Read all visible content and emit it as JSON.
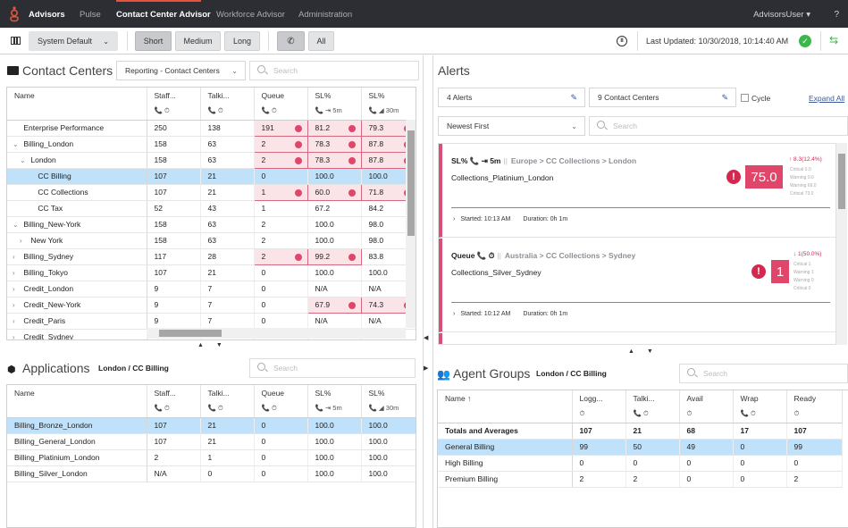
{
  "nav": {
    "brand": "Advisors",
    "items": [
      "Pulse",
      "Contact Center Advisor",
      "Workforce Advisor",
      "Administration"
    ],
    "active": "Contact Center Advisor",
    "user": "AdvisorsUser ▾",
    "help": "?"
  },
  "toolbar": {
    "layout_select": "System Default",
    "time_buttons": [
      "Short",
      "Medium",
      "Long"
    ],
    "media_buttons": [
      "phone",
      "All"
    ],
    "last_updated": "Last Updated: 10/30/2018, 10:14:40 AM",
    "status": "connected"
  },
  "contact_centers": {
    "title": "Contact Centers",
    "grouping": "Reporting - Contact Centers",
    "search_placeholder": "Search",
    "columns": [
      {
        "label": "Name",
        "sub": ""
      },
      {
        "label": "Staff...",
        "sub": "📞 ⏱"
      },
      {
        "label": "Talki...",
        "sub": "📞 ⏱"
      },
      {
        "label": "Queue",
        "sub": "📞 ⏱"
      },
      {
        "label": "SL%",
        "sub": "📞 ⇥ 5m"
      },
      {
        "label": "SL%",
        "sub": "📞 ◢ 30m"
      }
    ],
    "rows": [
      {
        "toggle": "",
        "indent": 1,
        "name": "Enterprise Performance",
        "staff": "250",
        "talking": "138",
        "queue": "191",
        "sl5": "81.2",
        "sl30": "79.3",
        "alerts": [
          "queue",
          "sl5",
          "sl30"
        ]
      },
      {
        "toggle": "⌄",
        "indent": 1,
        "name": "Billing_London",
        "staff": "158",
        "talking": "63",
        "queue": "2",
        "sl5": "78.3",
        "sl30": "87.8",
        "alerts": [
          "queue",
          "sl5",
          "sl30"
        ]
      },
      {
        "toggle": "⌄",
        "indent": 2,
        "name": "London",
        "staff": "158",
        "talking": "63",
        "queue": "2",
        "sl5": "78.3",
        "sl30": "87.8",
        "alerts": [
          "queue",
          "sl5",
          "sl30"
        ]
      },
      {
        "toggle": "",
        "indent": 3,
        "name": "CC Billing",
        "staff": "107",
        "talking": "21",
        "queue": "0",
        "sl5": "100.0",
        "sl30": "100.0",
        "alerts": [],
        "selected": true
      },
      {
        "toggle": "",
        "indent": 3,
        "name": "CC Collections",
        "staff": "107",
        "talking": "21",
        "queue": "1",
        "sl5": "60.0",
        "sl30": "71.8",
        "alerts": [
          "queue",
          "sl5",
          "sl30"
        ]
      },
      {
        "toggle": "",
        "indent": 3,
        "name": "CC Tax",
        "staff": "52",
        "talking": "43",
        "queue": "1",
        "sl5": "67.2",
        "sl30": "84.2",
        "alerts": []
      },
      {
        "toggle": "⌄",
        "indent": 1,
        "name": "Billing_New-York",
        "staff": "158",
        "talking": "63",
        "queue": "2",
        "sl5": "100.0",
        "sl30": "98.0",
        "alerts": []
      },
      {
        "toggle": "›",
        "indent": 2,
        "name": "New York",
        "staff": "158",
        "talking": "63",
        "queue": "2",
        "sl5": "100.0",
        "sl30": "98.0",
        "alerts": []
      },
      {
        "toggle": "›",
        "indent": 1,
        "name": "Billing_Sydney",
        "staff": "117",
        "talking": "28",
        "queue": "2",
        "sl5": "99.2",
        "sl30": "83.8",
        "alerts": [
          "queue",
          "sl5"
        ]
      },
      {
        "toggle": "›",
        "indent": 1,
        "name": "Billing_Tokyo",
        "staff": "107",
        "talking": "21",
        "queue": "0",
        "sl5": "100.0",
        "sl30": "100.0",
        "alerts": []
      },
      {
        "toggle": "›",
        "indent": 1,
        "name": "Credit_London",
        "staff": "9",
        "talking": "7",
        "queue": "0",
        "sl5": "N/A",
        "sl30": "N/A",
        "alerts": []
      },
      {
        "toggle": "›",
        "indent": 1,
        "name": "Credit_New-York",
        "staff": "9",
        "talking": "7",
        "queue": "0",
        "sl5": "67.9",
        "sl30": "74.3",
        "alerts": [
          "sl5",
          "sl30"
        ]
      },
      {
        "toggle": "›",
        "indent": 1,
        "name": "Credit_Paris",
        "staff": "9",
        "talking": "7",
        "queue": "0",
        "sl5": "N/A",
        "sl30": "N/A",
        "alerts": []
      },
      {
        "toggle": "›",
        "indent": 1,
        "name": "Credit_Sydney",
        "staff": "",
        "talking": "",
        "queue": "",
        "sl5": "",
        "sl30": "",
        "alerts": []
      }
    ]
  },
  "applications": {
    "title": "Applications",
    "context": "London / CC Billing",
    "search_placeholder": "Search",
    "columns": [
      {
        "label": "Name",
        "sub": ""
      },
      {
        "label": "Staff...",
        "sub": "📞 ⏱"
      },
      {
        "label": "Talki...",
        "sub": "📞 ⏱"
      },
      {
        "label": "Queue",
        "sub": "📞 ⏱"
      },
      {
        "label": "SL%",
        "sub": "📞 ⇥ 5m"
      },
      {
        "label": "SL%",
        "sub": "📞 ◢ 30m"
      }
    ],
    "rows": [
      {
        "name": "Billing_Bronze_London",
        "staff": "107",
        "talking": "21",
        "queue": "0",
        "sl5": "100.0",
        "sl30": "100.0",
        "selected": true
      },
      {
        "name": "Billing_General_London",
        "staff": "107",
        "talking": "21",
        "queue": "0",
        "sl5": "100.0",
        "sl30": "100.0"
      },
      {
        "name": "Billing_Platinium_London",
        "staff": "2",
        "talking": "1",
        "queue": "0",
        "sl5": "100.0",
        "sl30": "100.0"
      },
      {
        "name": "Billing_Silver_London",
        "staff": "N/A",
        "talking": "0",
        "queue": "0",
        "sl5": "100.0",
        "sl30": "100.0"
      }
    ]
  },
  "alerts": {
    "title": "Alerts",
    "alert_filter": "4 Alerts",
    "cc_filter": "9 Contact Centers",
    "cycle_label": "Cycle",
    "expand_all": "Expand All",
    "sort": "Newest First",
    "search_placeholder": "Search",
    "cards": [
      {
        "metric": "SL% 📞 ⇥ 5m",
        "path": "Europe > CC Collections > London",
        "name": "Collections_Platinium_London",
        "value": "75.0",
        "delta": "↑ 8.3(12.4%)",
        "thresholds": [
          "Critical 0.0",
          "Warning 0.0",
          "Warning 69.0",
          "Critical 73.0"
        ],
        "started": "Started: 10:13 AM",
        "duration": "Duration: 0h 1m"
      },
      {
        "metric": "Queue 📞 ⏱",
        "path": "Australia > CC Collections > Sydney",
        "name": "Collections_Silver_Sydney",
        "value": "1",
        "delta": "↓ 1(50.0%)",
        "thresholds": [
          "Critical 1",
          "Warning 1",
          "Warning 0",
          "Critical 0"
        ],
        "started": "Started: 10:12 AM",
        "duration": "Duration: 0h 1m"
      }
    ]
  },
  "agent_groups": {
    "title": "Agent Groups",
    "context": "London / CC Billing",
    "search_placeholder": "Search",
    "columns": [
      {
        "label": "Name ↑",
        "sub": ""
      },
      {
        "label": "Logg...",
        "sub": "⏱"
      },
      {
        "label": "Talki...",
        "sub": "📞 ⏱"
      },
      {
        "label": "Avail",
        "sub": "⏱"
      },
      {
        "label": "Wrap",
        "sub": "📞 ⏱"
      },
      {
        "label": "Ready",
        "sub": "⏱"
      }
    ],
    "rows": [
      {
        "name": "Totals and Averages",
        "logged": "107",
        "talking": "21",
        "avail": "68",
        "wrap": "17",
        "ready": "107",
        "bold": true
      },
      {
        "name": "General Billing",
        "logged": "99",
        "talking": "50",
        "avail": "49",
        "wrap": "0",
        "ready": "99",
        "selected": true
      },
      {
        "name": "High Billing",
        "logged": "0",
        "talking": "0",
        "avail": "0",
        "wrap": "0",
        "ready": "0"
      },
      {
        "name": "Premium Billing",
        "logged": "2",
        "talking": "2",
        "avail": "0",
        "wrap": "0",
        "ready": "2"
      }
    ]
  }
}
